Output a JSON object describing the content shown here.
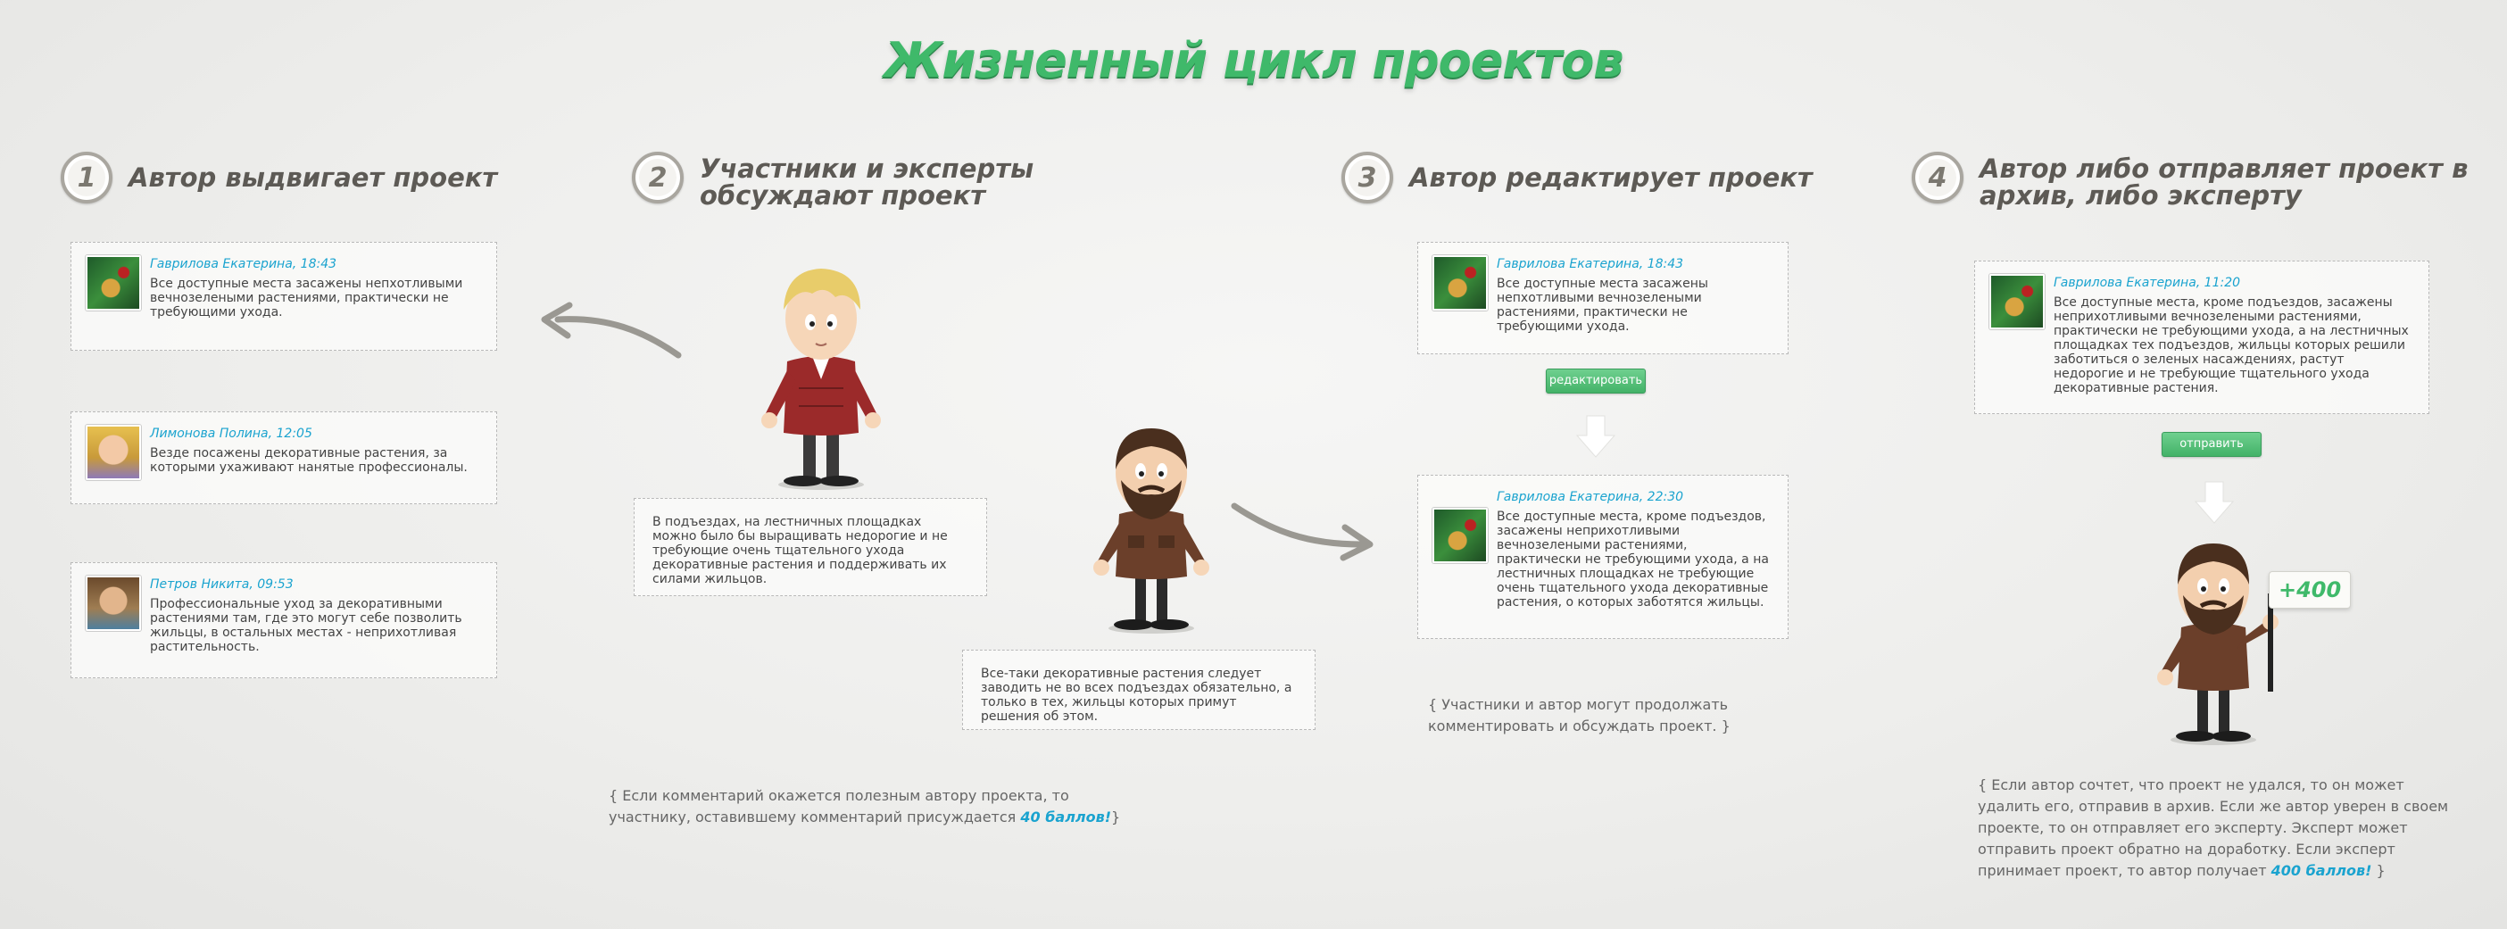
{
  "title": "Жизненный цикл проектов",
  "steps": [
    {
      "num": "1",
      "title": "Автор выдвигает проект"
    },
    {
      "num": "2",
      "title": "Участники и эксперты обсуждают проект"
    },
    {
      "num": "3",
      "title": "Автор редактирует проект"
    },
    {
      "num": "4",
      "title": "Автор либо отправляет проект в архив, либо эксперту"
    }
  ],
  "step1_comments": [
    {
      "author": "Гаврилова Екатерина, 18:43",
      "text": "Все доступные места засажены непхотливыми вечнозелеными растениями, практически не требующими ухода."
    },
    {
      "author": "Лимонова Полина, 12:05",
      "text": "Везде посажены декоративные растения, за которыми ухаживают нанятые профессионалы."
    },
    {
      "author": "Петров Никита, 09:53",
      "text": "Профессиональные уход за декоративными растениями там, где это могут себе позволить жильцы, в остальных местах - неприхотливая растительность."
    }
  ],
  "step2_notes": [
    "В подъездах, на лестничных площадках можно было бы выращивать недорогие и не требующие очень тщательного ухода декоративные растения и поддерживать их силами жильцов.",
    "Все-таки декоративные растения следует заводить не во всех подъездах обязательно, а только в тех, жильцы которых примут решения об этом."
  ],
  "step2_comment": {
    "text": "{ Если комментарий окажется полезным автору проекта, то участнику, оставившему комментарий присуждается ",
    "highlight": "40 баллов!",
    "end": "}"
  },
  "step3": {
    "before": {
      "author": "Гаврилова Екатерина, 18:43",
      "text": "Все доступные места засажены непхотливыми вечнозелеными растениями, практически не требующими ухода."
    },
    "edit_button": "редактировать",
    "after": {
      "author": "Гаврилова Екатерина, 22:30",
      "text": "Все доступные места, кроме подъездов, засажены неприхотливыми вечнозелеными растениями, практически не требующими ухода, а на лестничных площадках не требующие очень тщательного ухода декоративные растения, о которых заботятся жильцы."
    },
    "comment": "{ Участники и автор могут продолжать комментировать и обсуждать проект. }"
  },
  "step4": {
    "card": {
      "author": "Гаврилова Екатерина, 11:20",
      "text": "Все доступные места, кроме подъездов, засажены неприхотливыми вечнозелеными растениями, практически не требующими ухода, а на лестничных площадках тех подъездов, жильцы которых решили заботиться о зеленых насаждениях, растут недорогие и не требующие тщательного ухода декоративные растения."
    },
    "send_button": "отправить",
    "badge": "+400",
    "comment": "{ Если автор сочтет, что проект не удался, то он может удалить его, отправив в архив. Если же автор уверен в своем проекте, то он отправляет его эксперту. Эксперт может отправить проект обратно на доработку. Если эксперт принимает проект, то автор получает ",
    "highlight": "400 баллов!",
    "end": " }"
  },
  "colors": {
    "accent_green": "#3fb96a",
    "author_blue": "#1aa3cf",
    "step_gray": "#5d5a55"
  }
}
